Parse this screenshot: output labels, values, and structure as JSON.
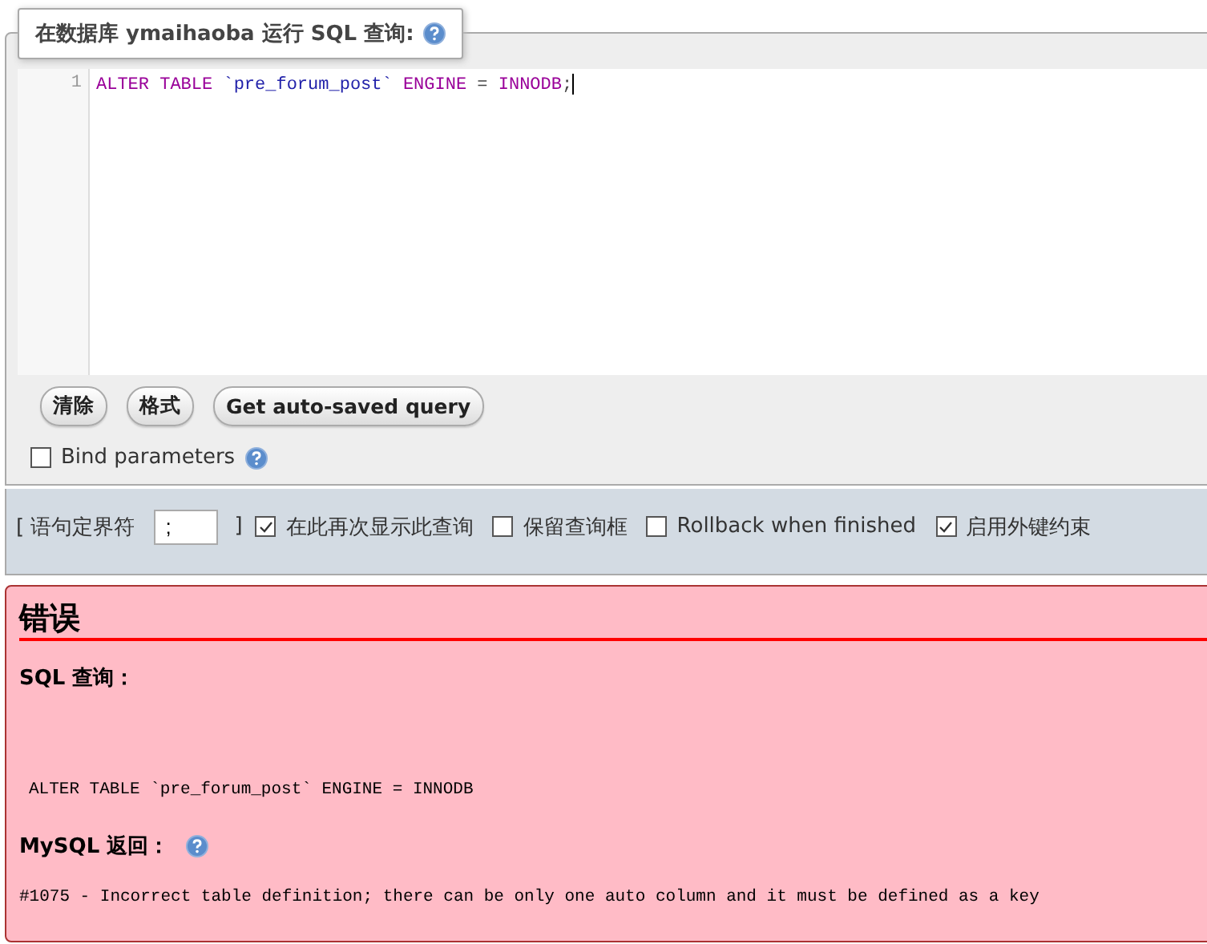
{
  "query_panel": {
    "legend": "在数据库 ymaihaoba 运行 SQL 查询:",
    "editor": {
      "line_numbers": [
        "1"
      ],
      "tokens": [
        {
          "kind": "keyword",
          "text": "ALTER TABLE"
        },
        {
          "kind": "identifier",
          "text": " `pre_forum_post`"
        },
        {
          "kind": "keyword",
          "text": " ENGINE"
        },
        {
          "kind": "plain",
          "text": " = "
        },
        {
          "kind": "keyword",
          "text": "INNODB"
        },
        {
          "kind": "plain",
          "text": ";"
        }
      ]
    },
    "buttons": [
      "清除",
      "格式",
      "Get auto-saved query"
    ],
    "bind_parameters": {
      "label": "Bind parameters",
      "checked": false
    }
  },
  "options_bar": {
    "delimiter_open": "[ 语句定界符",
    "delimiter_value": ";",
    "delimiter_close": "]",
    "options": [
      {
        "label": "在此再次显示此查询",
        "checked": true
      },
      {
        "label": "保留查询框",
        "checked": false
      },
      {
        "label": "Rollback when finished",
        "checked": false
      },
      {
        "label": "启用外键约束",
        "checked": true
      }
    ]
  },
  "error": {
    "title": "错误",
    "query_heading": "SQL 查询：",
    "query": "ALTER TABLE `pre_forum_post` ENGINE = INNODB",
    "return_heading": "MySQL 返回：",
    "message": "#1075 - Incorrect table definition; there can be only one auto column and it must be defined as a key"
  }
}
